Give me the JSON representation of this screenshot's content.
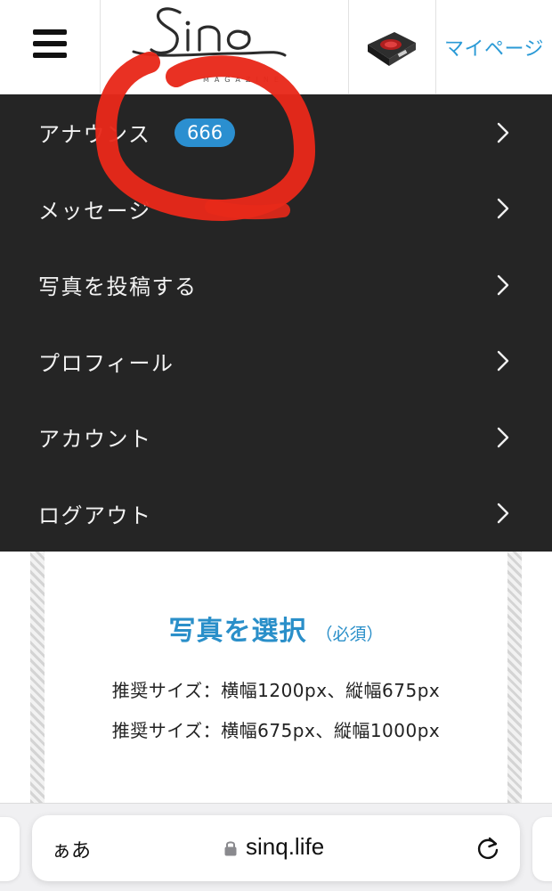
{
  "header": {
    "logo_text": "Sinq",
    "logo_tagline": "MAGAZINE",
    "mypage_label": "マイページ"
  },
  "icons": {
    "menu": "hamburger-icon",
    "chevron": "chevron-right-icon",
    "lock": "lock-icon",
    "reload": "reload-icon",
    "thumbnail": "cooktop-thumbnail"
  },
  "menu": {
    "items": [
      {
        "label": "アナウンス",
        "badge": "666"
      },
      {
        "label": "メッセージ"
      },
      {
        "label": "写真を投稿する"
      },
      {
        "label": "プロフィール"
      },
      {
        "label": "アカウント"
      },
      {
        "label": "ログアウト"
      }
    ]
  },
  "upload": {
    "title": "写真を選択",
    "required": "（必須）",
    "size_lines": [
      "推奨サイズ：横幅1200px、縦幅675px",
      "推奨サイズ：横幅675px、縦幅1000px"
    ]
  },
  "browser": {
    "text_size_label": "ぁあ",
    "domain": "sinq.life"
  },
  "colors": {
    "menu_bg": "#252525",
    "accent_blue": "#2a9ad6",
    "badge_blue": "#2b8fd0",
    "annotation_red": "#e8291a"
  }
}
